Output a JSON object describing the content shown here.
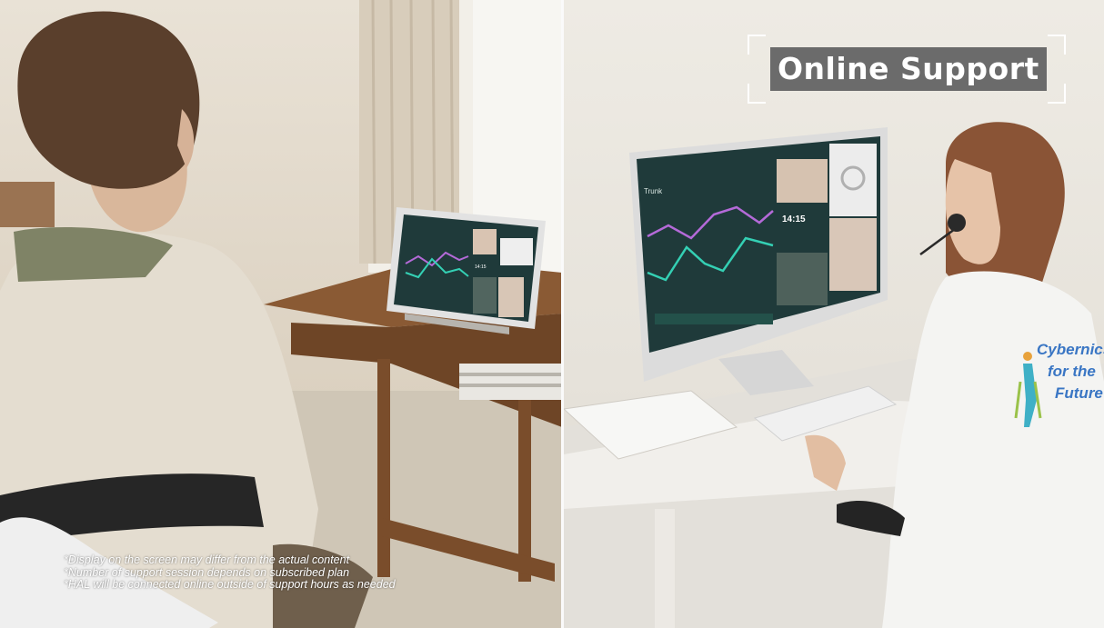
{
  "overlay": {
    "title": "Online Support"
  },
  "disclaimers": [
    "*Display on the screen may differ from the actual content",
    "*Number of support session depends on subscribed plan",
    "*HAL will be connected online outside of support hours as needed"
  ],
  "monitor": {
    "graph_label": "Trunk",
    "time": "14:15"
  },
  "tablet": {
    "time": "14:15"
  },
  "shirt": {
    "lines": [
      "Cybernics",
      "for the",
      "Future"
    ]
  },
  "colors": {
    "overlay_box": "#6b6b6b",
    "screen_bg": "#1f3a3a",
    "curve_purple": "#b46ad8",
    "curve_teal": "#34d0b4",
    "desk_wood": "#8a5a34",
    "uniform": "#f4f4f2"
  }
}
